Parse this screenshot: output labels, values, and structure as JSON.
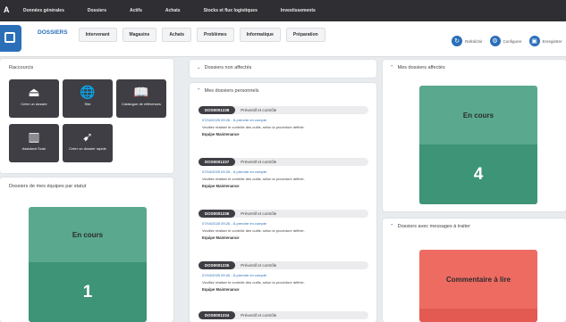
{
  "topmenu": [
    "Données générales",
    "Dossiers",
    "Actifs",
    "Achats",
    "Stocks et flux logistiques",
    "Investissements"
  ],
  "tabs": [
    {
      "label": "DOSSIERS",
      "active": true
    },
    {
      "label": "Intervenant",
      "active": false
    },
    {
      "label": "Magasins",
      "active": false
    },
    {
      "label": "Achats",
      "active": false
    },
    {
      "label": "Problèmes",
      "active": false
    },
    {
      "label": "Informatique",
      "active": false
    },
    {
      "label": "Préparation",
      "active": false
    }
  ],
  "actions": [
    {
      "label": "Rafraîchir",
      "icon": "refresh-icon"
    },
    {
      "label": "Configurer",
      "icon": "gear-icon"
    },
    {
      "label": "Enregistrer",
      "icon": "save-icon"
    }
  ],
  "shortcuts": {
    "title": "Raccourcis",
    "items": [
      {
        "label": "Créer un dossier",
        "icon": "inbox-icon"
      },
      {
        "label": "Site",
        "icon": "globe-icon"
      },
      {
        "label": "Catalogue de références",
        "icon": "book-icon"
      },
      {
        "label": "Assistant Scan",
        "icon": "barcode-icon"
      },
      {
        "label": "Créer un dossier rapide",
        "icon": "send-icon"
      }
    ]
  },
  "team_status": {
    "title": "Dossiers de mes équipes par statut",
    "card": {
      "label": "En cours",
      "count": "1"
    }
  },
  "unassigned": {
    "title": "Dossiers non affectés"
  },
  "personal": {
    "title": "Mes dossiers personnels",
    "items": [
      {
        "number": "DOS0001238",
        "type": "Préventif et contrôle",
        "meta": "07/04/2025 09:26 - À prendre en compte",
        "desc": "Veuillez réaliser le contrôle des outils, selon la procédure définie.",
        "team": "Equipe Maintenance"
      },
      {
        "number": "DOS0001237",
        "type": "Préventif et contrôle",
        "meta": "07/04/2025 09:26 - À prendre en compte",
        "desc": "Veuillez réaliser le contrôle des outils, selon la procédure définie.",
        "team": "Equipe Maintenance"
      },
      {
        "number": "DOS0001236",
        "type": "Préventif et contrôle",
        "meta": "07/04/2025 09:26 - À prendre en compte",
        "desc": "Veuillez réaliser le contrôle des outils, selon la procédure définie.",
        "team": "Equipe Maintenance"
      },
      {
        "number": "DOS0001235",
        "type": "Préventif et contrôle",
        "meta": "07/04/2025 09:26 - À prendre en compte",
        "desc": "Veuillez réaliser le contrôle des outils, selon la procédure définie.",
        "team": "Equipe Maintenance"
      },
      {
        "number": "DOS0001234",
        "type": "Préventif et contrôle",
        "meta": "",
        "desc": "",
        "team": ""
      }
    ]
  },
  "assigned": {
    "title": "Mes dossiers affectés",
    "card": {
      "label": "En cours",
      "count": "4"
    }
  },
  "messages": {
    "title": "Dossiers avec messages à traiter",
    "card": {
      "label": "Commentaire à lire"
    }
  },
  "colors": {
    "accent": "#2a6fb8",
    "card_green": "#5aa98f",
    "card_green_dark": "#3d9477",
    "card_red": "#ee6b62",
    "card_red_dark": "#e25a52"
  }
}
